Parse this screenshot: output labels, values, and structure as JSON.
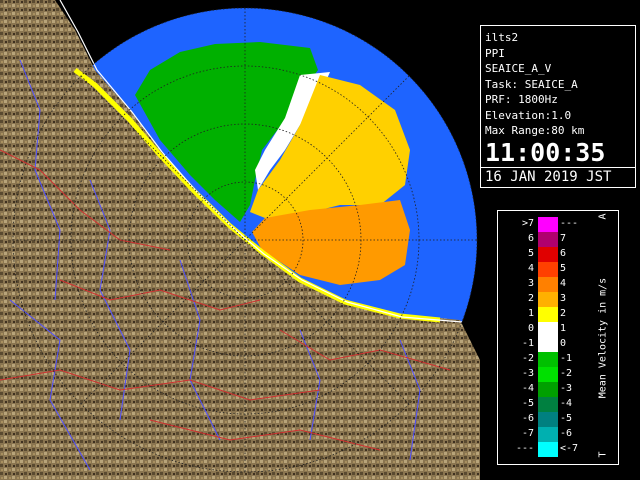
{
  "info": {
    "site": "ilts2",
    "product": "PPI",
    "scan": "SEAICE_A_V",
    "task": "Task: SEAICE_A",
    "prf": "PRF: 1800Hz",
    "elevation": "Elevation:1.0",
    "max_range": "Max Range:80 km",
    "time": "11:00:35",
    "date": "16 JAN 2019 JST"
  },
  "legend": {
    "title": "Mean Velocity in m/s",
    "top_tick": "A",
    "bottom_tick": "T",
    "rows": [
      {
        "left": ">7",
        "right": "---",
        "color": "#ff00ff"
      },
      {
        "left": "6",
        "right": "7",
        "color": "#b0006e"
      },
      {
        "left": "5",
        "right": "6",
        "color": "#e00000"
      },
      {
        "left": "4",
        "right": "5",
        "color": "#ff4000"
      },
      {
        "left": "3",
        "right": "4",
        "color": "#ff8000"
      },
      {
        "left": "2",
        "right": "3",
        "color": "#ffb000"
      },
      {
        "left": "1",
        "right": "2",
        "color": "#ffff00"
      },
      {
        "left": "0",
        "right": "1",
        "color": "#ffffff"
      },
      {
        "left": "-1",
        "right": "0",
        "color": "#ffffff"
      },
      {
        "left": "-2",
        "right": "-1",
        "color": "#00c000"
      },
      {
        "left": "-3",
        "right": "-2",
        "color": "#00e000"
      },
      {
        "left": "-4",
        "right": "-3",
        "color": "#00a000"
      },
      {
        "left": "-5",
        "right": "-4",
        "color": "#008040"
      },
      {
        "left": "-6",
        "right": "-5",
        "color": "#008080"
      },
      {
        "left": "-7",
        "right": "-6",
        "color": "#00b0b0"
      },
      {
        "left": "---",
        "right": "<-7",
        "color": "#00ffff"
      }
    ]
  },
  "map": {
    "land_color": "#8a7550",
    "sea_color": "#1e64ff",
    "ring_color": "#222222",
    "coast_color": "#ffffff",
    "river_color": "#5050ff",
    "border_color": "#d03030"
  }
}
